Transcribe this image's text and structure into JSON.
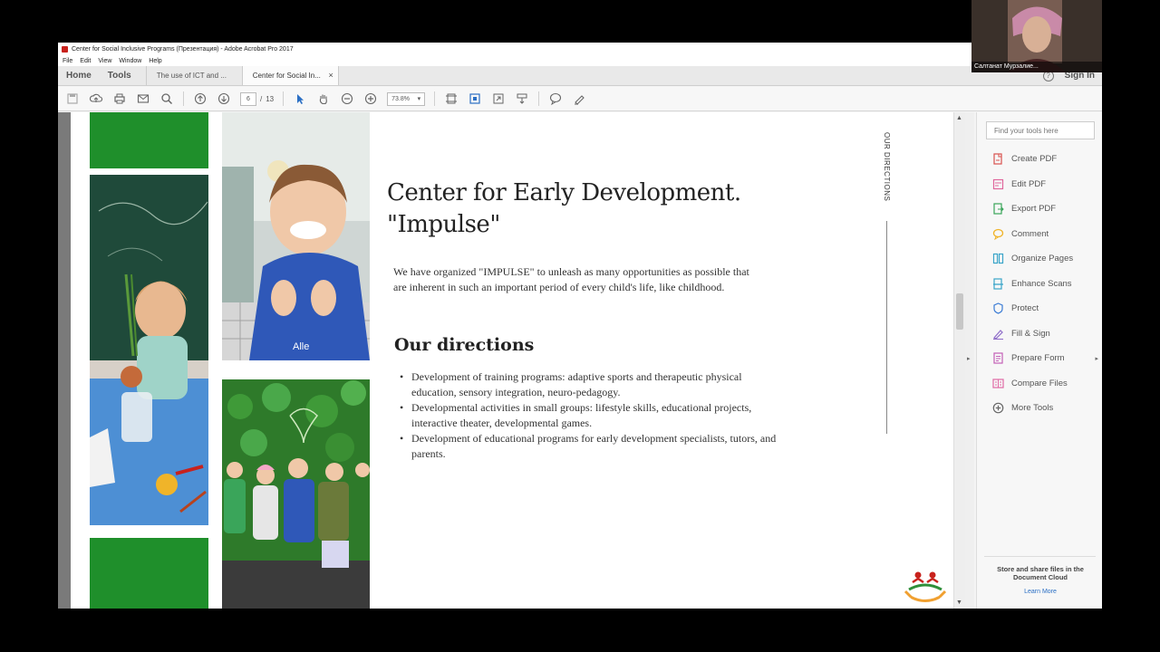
{
  "window": {
    "title": "Center for Social Inclusive Programs (Презентация) - Adobe Acrobat Pro 2017",
    "menu": [
      "File",
      "Edit",
      "View",
      "Window",
      "Help"
    ]
  },
  "tabs": {
    "home": "Home",
    "tools": "Tools",
    "doc1": "The use of ICT and ...",
    "doc2": "Center for Social In...",
    "close": "×",
    "help": "?",
    "signin": "Sign In"
  },
  "toolbar": {
    "page_current": "6",
    "page_sep": "/",
    "page_total": "13",
    "zoom": "73.8%"
  },
  "slide": {
    "heading_line1": "Center for Early Development.",
    "heading_line2": "\"Impulse\"",
    "intro": "We have organized \"IMPULSE\" to unleash as many opportunities as possible that are inherent in such an important period of every child's life, like childhood.",
    "subhead": "Our directions",
    "bullets": [
      "Development of training programs: adaptive sports and therapeutic physical education, sensory integration, neuro-pedagogy.",
      "Developmental activities in small groups: lifestyle skills, educational projects, interactive theater, developmental games.",
      "Development of educational programs for early development specialists, tutors, and parents."
    ],
    "side_label": "OUR DIRECTIONS",
    "photo_text": "Alle"
  },
  "tools_pane": {
    "search_placeholder": "Find your tools here",
    "items": [
      {
        "label": "Create PDF",
        "icon": "create-pdf-icon",
        "color": "#d9534f"
      },
      {
        "label": "Edit PDF",
        "icon": "edit-pdf-icon",
        "color": "#e0679c"
      },
      {
        "label": "Export PDF",
        "icon": "export-pdf-icon",
        "color": "#3aa55a"
      },
      {
        "label": "Comment",
        "icon": "comment-icon",
        "color": "#f0b429"
      },
      {
        "label": "Organize Pages",
        "icon": "organize-pages-icon",
        "color": "#3aa5c9"
      },
      {
        "label": "Enhance Scans",
        "icon": "enhance-scans-icon",
        "color": "#3aa5c9"
      },
      {
        "label": "Protect",
        "icon": "protect-icon",
        "color": "#3a7bd5"
      },
      {
        "label": "Fill & Sign",
        "icon": "fill-sign-icon",
        "color": "#8e6cc9"
      },
      {
        "label": "Prepare Form",
        "icon": "prepare-form-icon",
        "color": "#c35fb7"
      },
      {
        "label": "Compare Files",
        "icon": "compare-files-icon",
        "color": "#e06aa5"
      },
      {
        "label": "More Tools",
        "icon": "more-tools-icon",
        "color": "#666666"
      }
    ],
    "cloud_message": "Store and share files in the Document Cloud",
    "learn_more": "Learn More"
  },
  "webcam": {
    "name": "Салтанат Мурзалие..."
  },
  "colors": {
    "green_block": "#1f8f2b",
    "accent_link": "#2b6fc4"
  }
}
